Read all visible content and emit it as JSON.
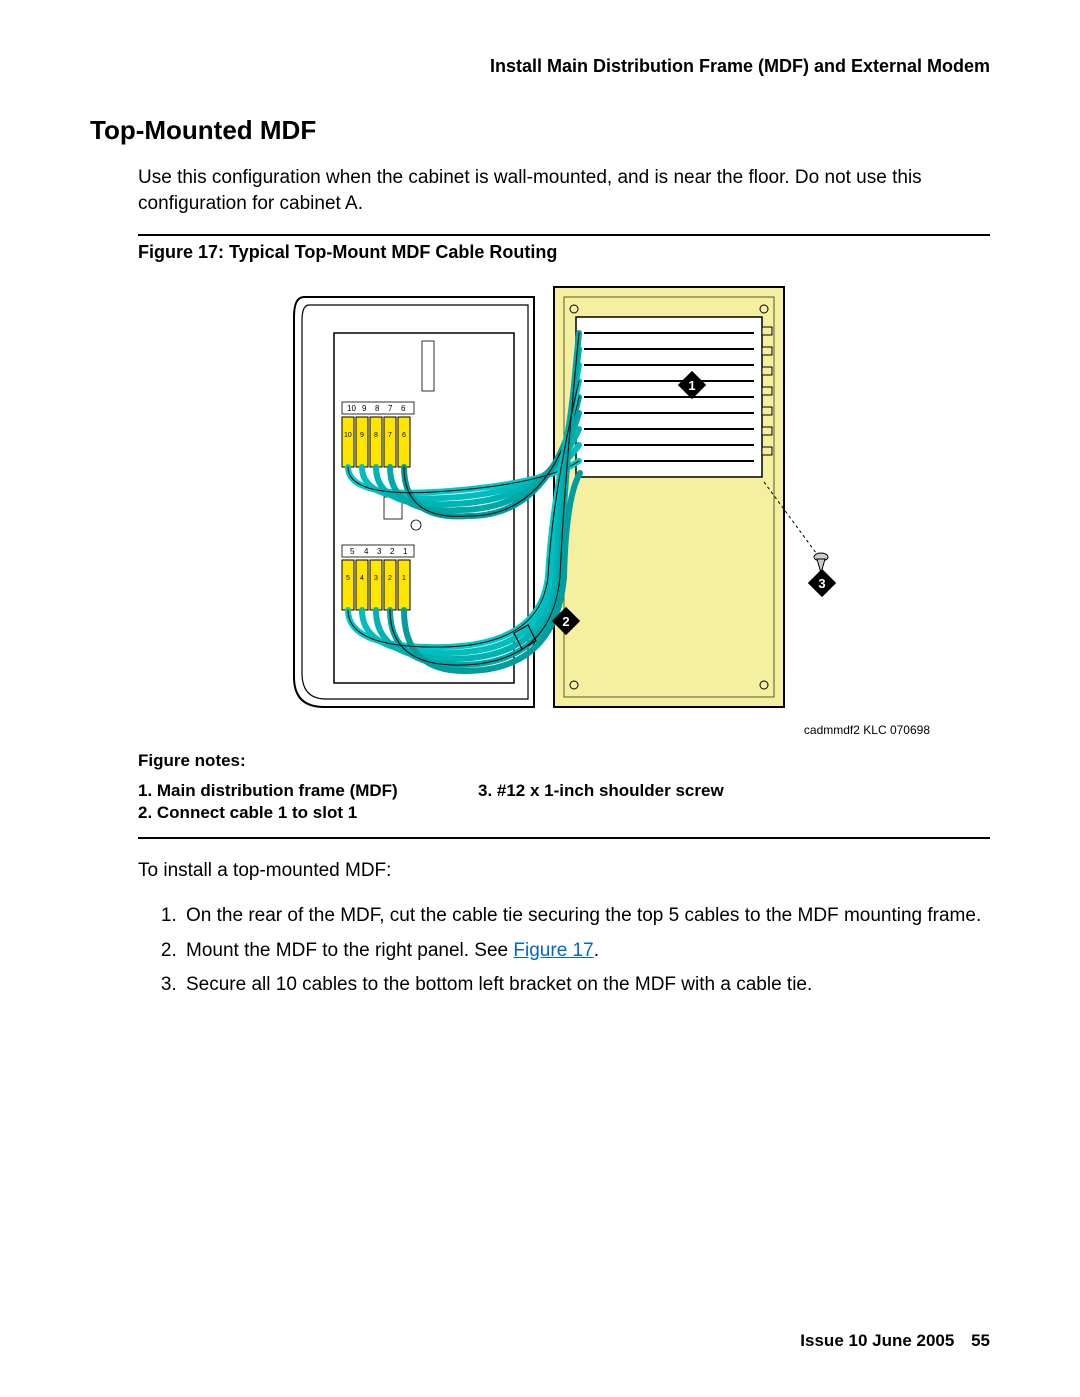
{
  "header": "Install Main Distribution Frame (MDF) and External Modem",
  "section_title": "Top-Mounted MDF",
  "intro": "Use this configuration when the cabinet is wall-mounted, and is near the floor. Do not use this configuration for cabinet A.",
  "figure": {
    "caption": "Figure 17: Typical Top-Mount MDF Cable Routing",
    "id": "cadmmdf2 KLC 070698",
    "callouts": {
      "1": "1",
      "2": "2",
      "3": "3"
    },
    "top_row_labels_upper": [
      "10",
      "9",
      "8",
      "7",
      "6"
    ],
    "top_row_labels_lower": [
      "10",
      "9",
      "8",
      "7",
      "6"
    ],
    "bottom_row_labels_upper": [
      "5",
      "4",
      "3",
      "2",
      "1"
    ],
    "bottom_row_labels_lower": [
      "5",
      "4",
      "3",
      "2",
      "1"
    ]
  },
  "notes": {
    "title": "Figure notes:",
    "col1": [
      "1. Main distribution frame (MDF)",
      "2. Connect cable 1 to slot 1"
    ],
    "col2": [
      "3.  #12 x 1-inch shoulder screw"
    ]
  },
  "install_lead": "To install a top-mounted MDF:",
  "steps": [
    "On the rear of the MDF, cut the cable tie securing the top 5 cables to the MDF mounting frame.",
    "Mount the MDF to the right panel. See ",
    "Secure all 10 cables to the bottom left bracket on the MDF with a cable tie."
  ],
  "fig_link_text": "Figure 17",
  "footer": {
    "issue": "Issue 10   June 2005",
    "page": "55"
  }
}
